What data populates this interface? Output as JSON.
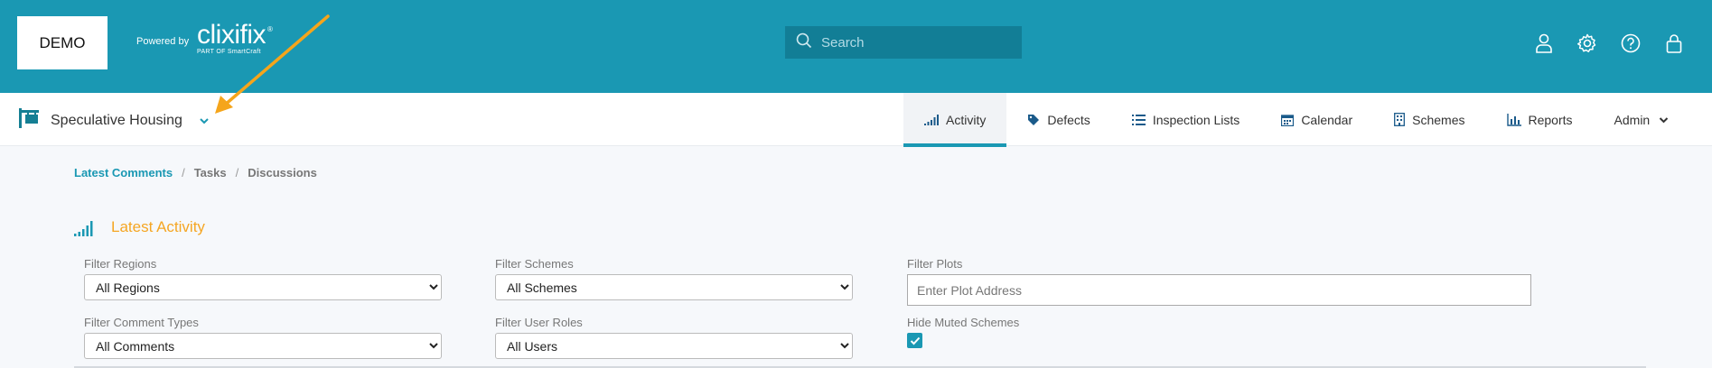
{
  "header": {
    "logo_text": "DEMO",
    "powered_by": "Powered by",
    "brand_name": "clixifix",
    "brand_sub": "PART OF SmartCraft",
    "brand_reg": "®",
    "search_placeholder": "Search",
    "icons": [
      "user-icon",
      "gear-icon",
      "help-icon",
      "lock-icon"
    ]
  },
  "nav": {
    "scheme_label": "Speculative Housing",
    "tabs": [
      {
        "label": "Activity",
        "icon": "signal-bars-icon",
        "active": true
      },
      {
        "label": "Defects",
        "icon": "tag-icon"
      },
      {
        "label": "Inspection Lists",
        "icon": "list-icon"
      },
      {
        "label": "Calendar",
        "icon": "calendar-icon"
      },
      {
        "label": "Schemes",
        "icon": "building-icon"
      },
      {
        "label": "Reports",
        "icon": "bar-chart-icon"
      },
      {
        "label": "Admin",
        "icon": "chevron-down-icon"
      }
    ]
  },
  "breadcrumb": {
    "items": [
      "Latest Comments",
      "Tasks",
      "Discussions"
    ],
    "separator": "/"
  },
  "section": {
    "title": "Latest Activity"
  },
  "filters": {
    "regions": {
      "label": "Filter Regions",
      "value": "All Regions"
    },
    "schemes": {
      "label": "Filter Schemes",
      "value": "All Schemes"
    },
    "plots": {
      "label": "Filter Plots",
      "placeholder": "Enter Plot Address"
    },
    "comment_types": {
      "label": "Filter Comment Types",
      "value": "All Comments"
    },
    "user_roles": {
      "label": "Filter User Roles",
      "value": "All Users"
    },
    "hide_muted": {
      "label": "Hide Muted Schemes",
      "checked": true
    }
  },
  "colors": {
    "brand_teal": "#1a98b3",
    "search_bg": "#127e96",
    "accent_orange": "#f5a623",
    "annotation_arrow": "#f5a51b"
  }
}
